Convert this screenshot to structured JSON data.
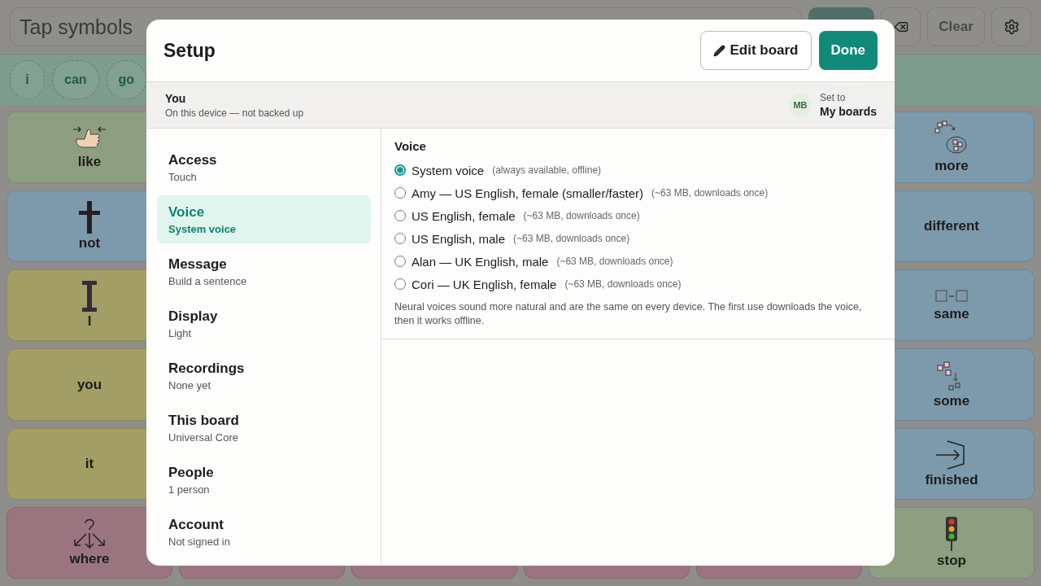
{
  "top_bar": {
    "message_placeholder": "Tap symbols",
    "clear_label": "Clear"
  },
  "chips": [
    "i",
    "can",
    "go"
  ],
  "board": {
    "left_column": [
      {
        "label": "like",
        "color": "#8d9f80",
        "kind": "hand"
      },
      {
        "label": "not",
        "color": "#7d9aac",
        "kind": "cross"
      },
      {
        "label": "I",
        "color": "#a29e66",
        "kind": "letter"
      },
      {
        "label": "you",
        "color": "#a29e66",
        "kind": "none"
      },
      {
        "label": "it",
        "color": "#a29e66",
        "kind": "none"
      },
      {
        "label": "where",
        "color": "#9a7580",
        "kind": "where"
      }
    ],
    "right_column": [
      {
        "label": "more",
        "color": "#7d9aac",
        "kind": "more"
      },
      {
        "label": "different",
        "color": "#7d9aac",
        "kind": "none"
      },
      {
        "label": "same",
        "color": "#7d9aac",
        "kind": "same"
      },
      {
        "label": "some",
        "color": "#7d9aac",
        "kind": "some"
      },
      {
        "label": "finished",
        "color": "#7d9aac",
        "kind": "finished"
      },
      {
        "label": "stop",
        "color": "#8d9f80",
        "kind": "stop"
      }
    ],
    "bottom_middle": [
      {
        "color": "#9a7580"
      },
      {
        "color": "#9a7580"
      },
      {
        "color": "#9a7580"
      },
      {
        "color": "#9a7580"
      }
    ]
  },
  "dialog": {
    "title": "Setup",
    "edit_button": "Edit board",
    "done_button": "Done",
    "profile": {
      "name": "You",
      "status": "On this device — not backed up",
      "avatar": "MB",
      "set_to_label": "Set to",
      "set_to_value": "My boards"
    },
    "sidebar": [
      {
        "label": "Access",
        "sub": "Touch",
        "selected": false
      },
      {
        "label": "Voice",
        "sub": "System voice",
        "selected": true
      },
      {
        "label": "Message",
        "sub": "Build a sentence",
        "selected": false
      },
      {
        "label": "Display",
        "sub": "Light",
        "selected": false
      },
      {
        "label": "Recordings",
        "sub": "None yet",
        "selected": false
      },
      {
        "label": "This board",
        "sub": "Universal Core",
        "selected": false
      },
      {
        "label": "People",
        "sub": "1 person",
        "selected": false
      },
      {
        "label": "Account",
        "sub": "Not signed in",
        "selected": false
      }
    ],
    "voice": {
      "heading": "Voice",
      "options": [
        {
          "name": "System voice",
          "note": "(always available, offline)",
          "selected": true
        },
        {
          "name": "Amy — US English, female (smaller/faster)",
          "note": "(~63 MB, downloads once)",
          "selected": false
        },
        {
          "name": "US English, female",
          "note": "(~63 MB, downloads once)",
          "selected": false
        },
        {
          "name": "US English, male",
          "note": "(~63 MB, downloads once)",
          "selected": false
        },
        {
          "name": "Alan — UK English, male",
          "note": "(~63 MB, downloads once)",
          "selected": false
        },
        {
          "name": "Cori — UK English, female",
          "note": "(~63 MB, downloads once)",
          "selected": false
        }
      ],
      "hint": "Neural voices sound more natural and are the same on every device. The first use downloads the voice, then it works offline."
    }
  }
}
